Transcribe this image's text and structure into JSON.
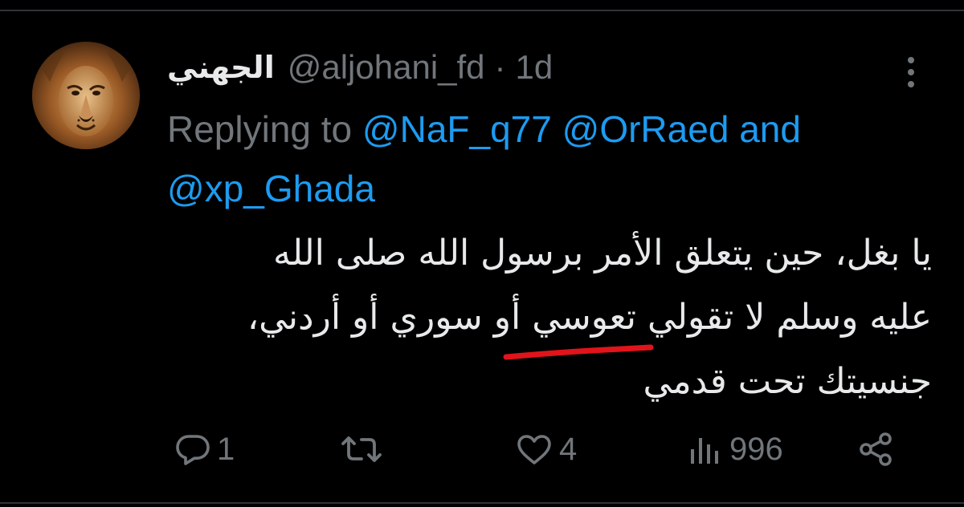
{
  "tweet": {
    "display_name": "الجهني",
    "handle": "@aljohani_fd",
    "separator": "·",
    "time": "1d",
    "replying_prefix": "Replying to",
    "mentions": [
      "@NaF_q77",
      "@OrRaed",
      "@xp_Ghada"
    ],
    "mention_joiner": "and",
    "text_lines": [
      "يا بغل، حين يتعلق الأمر برسول الله صلى الله",
      "عليه وسلم لا تقولي تعوسي أو سوري أو أردني،",
      "جنسيتك تحت قدمي"
    ],
    "underline_color": "#e0141a",
    "avatar_icon": "lion-avatar"
  },
  "actions": {
    "reply_icon": "reply-icon",
    "reply_count": "1",
    "retweet_icon": "retweet-icon",
    "retweet_count": "",
    "like_icon": "heart-icon",
    "like_count": "4",
    "views_icon": "views-icon",
    "views_count": "996",
    "share_icon": "share-icon"
  },
  "colors": {
    "background": "#000000",
    "text": "#e7e9ea",
    "muted": "#71767b",
    "link": "#1d9bf0"
  }
}
